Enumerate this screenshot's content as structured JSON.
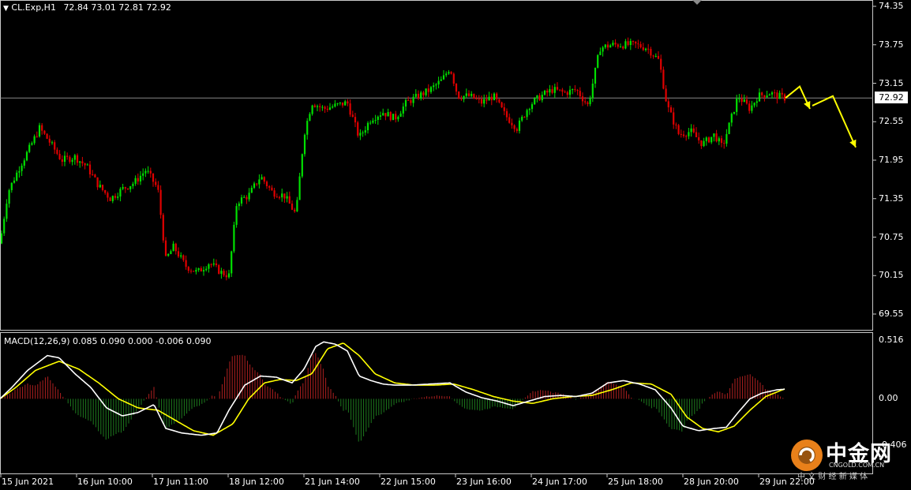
{
  "chart_header": {
    "symbol": "CL.Exp,H1",
    "ohlc": "72.84 73.01 72.81 72.92"
  },
  "macd_header": {
    "text": "MACD(12,26,9) 0.085 0.090 0.000 -0.006 0.090"
  },
  "price_axis": {
    "ticks": [
      "74.35",
      "73.75",
      "73.15",
      "72.55",
      "71.95",
      "71.35",
      "70.75",
      "70.15",
      "69.55"
    ],
    "current_price_label": "72.92"
  },
  "macd_axis": {
    "ticks": [
      "0.516",
      "0.00",
      "-0.406"
    ]
  },
  "time_axis": {
    "ticks": [
      "15 Jun 2021",
      "16 Jun 10:00",
      "17 Jun 11:00",
      "18 Jun 12:00",
      "21 Jun 14:00",
      "22 Jun 15:00",
      "23 Jun 16:00",
      "24 Jun 17:00",
      "25 Jun 18:00",
      "28 Jun 20:00",
      "29 Jun 22:00"
    ]
  },
  "watermark": {
    "brand": "中金网",
    "domain": "CNGOLD.COM.CN",
    "slogan": "中 文 财 经 新 媒 体"
  },
  "colors": {
    "background": "#000000",
    "bull_candle": "#00e000",
    "bear_candle": "#e00000",
    "macd_line": "#ffffff",
    "signal_line": "#ffff00",
    "hist_pos": "#b02020",
    "hist_neg": "#1e7a1e",
    "arrow": "#ffff00",
    "brand_orange": "#e8801a"
  },
  "chart_data": [
    {
      "type": "candlestick",
      "title": "CL.Exp,H1",
      "ylim": [
        69.35,
        74.45
      ],
      "current_price": 72.92,
      "anchor_closes": [
        [
          0,
          70.65
        ],
        [
          10,
          71.45
        ],
        [
          25,
          71.85
        ],
        [
          38,
          72.15
        ],
        [
          50,
          72.45
        ],
        [
          62,
          72.25
        ],
        [
          78,
          71.95
        ],
        [
          95,
          72.0
        ],
        [
          110,
          71.85
        ],
        [
          125,
          71.55
        ],
        [
          140,
          71.35
        ],
        [
          155,
          71.5
        ],
        [
          170,
          71.6
        ],
        [
          185,
          71.8
        ],
        [
          200,
          71.5
        ],
        [
          210,
          70.4
        ],
        [
          220,
          70.6
        ],
        [
          235,
          70.3
        ],
        [
          250,
          70.2
        ],
        [
          265,
          70.35
        ],
        [
          280,
          70.2
        ],
        [
          290,
          70.15
        ],
        [
          300,
          71.3
        ],
        [
          315,
          71.4
        ],
        [
          330,
          71.7
        ],
        [
          345,
          71.45
        ],
        [
          360,
          71.4
        ],
        [
          375,
          71.1
        ],
        [
          385,
          72.35
        ],
        [
          395,
          72.85
        ],
        [
          410,
          72.75
        ],
        [
          425,
          72.8
        ],
        [
          440,
          72.85
        ],
        [
          455,
          72.3
        ],
        [
          470,
          72.6
        ],
        [
          485,
          72.7
        ],
        [
          500,
          72.6
        ],
        [
          515,
          72.85
        ],
        [
          530,
          72.95
        ],
        [
          545,
          73.05
        ],
        [
          560,
          73.2
        ],
        [
          570,
          73.4
        ],
        [
          580,
          72.95
        ],
        [
          595,
          72.95
        ],
        [
          610,
          72.85
        ],
        [
          625,
          72.95
        ],
        [
          640,
          72.65
        ],
        [
          655,
          72.45
        ],
        [
          670,
          72.8
        ],
        [
          685,
          72.95
        ],
        [
          700,
          73.05
        ],
        [
          715,
          73.0
        ],
        [
          730,
          73.05
        ],
        [
          745,
          72.8
        ],
        [
          760,
          73.7
        ],
        [
          775,
          73.75
        ],
        [
          790,
          73.75
        ],
        [
          805,
          73.75
        ],
        [
          820,
          73.7
        ],
        [
          835,
          73.5
        ],
        [
          845,
          72.8
        ],
        [
          860,
          72.35
        ],
        [
          875,
          72.4
        ],
        [
          890,
          72.2
        ],
        [
          905,
          72.35
        ],
        [
          915,
          72.15
        ],
        [
          925,
          72.55
        ],
        [
          935,
          72.95
        ],
        [
          950,
          72.75
        ],
        [
          960,
          72.95
        ],
        [
          975,
          73.0
        ],
        [
          985,
          72.95
        ],
        [
          995,
          72.92
        ]
      ],
      "forecast_arrows": [
        [
          [
            995,
            72.92
          ],
          [
            1013,
            73.1
          ],
          [
            1026,
            72.75
          ]
        ],
        [
          [
            1029,
            72.8
          ],
          [
            1055,
            72.95
          ],
          [
            1084,
            72.15
          ]
        ]
      ]
    },
    {
      "type": "macd",
      "title": "MACD(12,26,9)",
      "params": [
        12,
        26,
        9
      ],
      "values": {
        "macd": 0.085,
        "signal": 0.09,
        "histogram": 0.0,
        "extra_1": -0.006,
        "extra_2": 0.09
      },
      "ylim": [
        -0.406,
        0.516
      ],
      "macd_line": [
        [
          0,
          0.0
        ],
        [
          15,
          0.1
        ],
        [
          35,
          0.25
        ],
        [
          60,
          0.38
        ],
        [
          75,
          0.36
        ],
        [
          95,
          0.22
        ],
        [
          115,
          0.1
        ],
        [
          135,
          -0.08
        ],
        [
          155,
          -0.15
        ],
        [
          175,
          -0.12
        ],
        [
          195,
          -0.05
        ],
        [
          210,
          -0.26
        ],
        [
          230,
          -0.3
        ],
        [
          255,
          -0.32
        ],
        [
          275,
          -0.3
        ],
        [
          290,
          -0.1
        ],
        [
          310,
          0.12
        ],
        [
          330,
          0.2
        ],
        [
          350,
          0.19
        ],
        [
          370,
          0.14
        ],
        [
          385,
          0.26
        ],
        [
          400,
          0.46
        ],
        [
          410,
          0.5
        ],
        [
          425,
          0.48
        ],
        [
          440,
          0.42
        ],
        [
          455,
          0.2
        ],
        [
          470,
          0.16
        ],
        [
          485,
          0.13
        ],
        [
          500,
          0.12
        ],
        [
          520,
          0.12
        ],
        [
          545,
          0.13
        ],
        [
          570,
          0.14
        ],
        [
          590,
          0.06
        ],
        [
          610,
          0.01
        ],
        [
          630,
          -0.02
        ],
        [
          650,
          -0.06
        ],
        [
          670,
          -0.02
        ],
        [
          690,
          0.02
        ],
        [
          710,
          0.03
        ],
        [
          730,
          0.02
        ],
        [
          750,
          0.05
        ],
        [
          770,
          0.14
        ],
        [
          790,
          0.16
        ],
        [
          810,
          0.13
        ],
        [
          830,
          0.08
        ],
        [
          850,
          -0.08
        ],
        [
          865,
          -0.24
        ],
        [
          885,
          -0.28
        ],
        [
          905,
          -0.26
        ],
        [
          920,
          -0.25
        ],
        [
          935,
          -0.12
        ],
        [
          950,
          0.0
        ],
        [
          965,
          0.05
        ],
        [
          985,
          0.08
        ],
        [
          995,
          0.085
        ]
      ],
      "signal_line": [
        [
          0,
          0.0
        ],
        [
          20,
          0.1
        ],
        [
          45,
          0.25
        ],
        [
          75,
          0.33
        ],
        [
          100,
          0.26
        ],
        [
          125,
          0.14
        ],
        [
          150,
          0.0
        ],
        [
          175,
          -0.08
        ],
        [
          200,
          -0.1
        ],
        [
          220,
          -0.18
        ],
        [
          245,
          -0.28
        ],
        [
          270,
          -0.32
        ],
        [
          295,
          -0.22
        ],
        [
          315,
          0.0
        ],
        [
          335,
          0.14
        ],
        [
          355,
          0.17
        ],
        [
          375,
          0.16
        ],
        [
          395,
          0.22
        ],
        [
          415,
          0.44
        ],
        [
          435,
          0.49
        ],
        [
          455,
          0.38
        ],
        [
          475,
          0.22
        ],
        [
          500,
          0.14
        ],
        [
          525,
          0.12
        ],
        [
          550,
          0.12
        ],
        [
          575,
          0.13
        ],
        [
          600,
          0.08
        ],
        [
          625,
          0.02
        ],
        [
          650,
          -0.02
        ],
        [
          675,
          -0.04
        ],
        [
          700,
          0.0
        ],
        [
          725,
          0.02
        ],
        [
          750,
          0.03
        ],
        [
          775,
          0.08
        ],
        [
          800,
          0.14
        ],
        [
          825,
          0.13
        ],
        [
          850,
          0.04
        ],
        [
          870,
          -0.16
        ],
        [
          890,
          -0.26
        ],
        [
          910,
          -0.29
        ],
        [
          930,
          -0.24
        ],
        [
          950,
          -0.1
        ],
        [
          970,
          0.02
        ],
        [
          995,
          0.09
        ]
      ]
    }
  ]
}
